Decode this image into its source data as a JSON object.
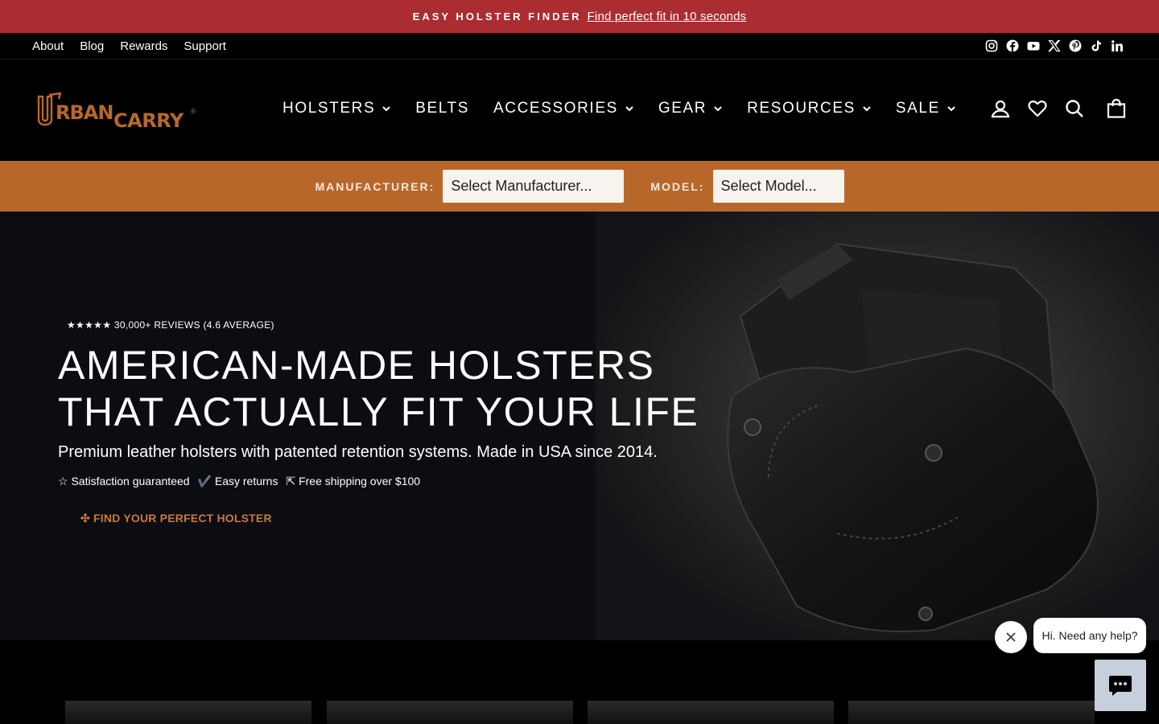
{
  "announcement": {
    "strong": "EASY HOLSTER FINDER",
    "link": "Find perfect fit in 10 seconds"
  },
  "utility": {
    "links": [
      "About",
      "Blog",
      "Rewards",
      "Support"
    ],
    "social_icons": [
      "instagram-icon",
      "facebook-icon",
      "youtube-icon",
      "x-icon",
      "pinterest-icon",
      "tiktok-icon",
      "linkedin-icon"
    ]
  },
  "header": {
    "logo_text": "URBAN CARRY",
    "nav": [
      "HOLSTERS",
      "BELTS",
      "ACCESSORIES",
      "GEAR",
      "RESOURCES",
      "SALE"
    ],
    "actions": [
      "account-icon",
      "wishlist-icon",
      "search-icon",
      "cart-icon"
    ]
  },
  "finder": {
    "manufacturer_label": "MANUFACTURER:",
    "manufacturer_value": "Select Manufacturer...",
    "model_label": "MODEL:",
    "model_value": "Select Model..."
  },
  "hero": {
    "reviews": "★★★★★ 30,000+ REVIEWS (4.6 AVERAGE)",
    "title": "AMERICAN-MADE HOLSTERS THAT ACTUALLY FIT YOUR LIFE",
    "subtitle": "Premium leather holsters with patented retention systems. Made in USA since 2014.",
    "perks": [
      "☆ Satisfaction guaranteed",
      "✔️ Easy returns",
      "⇱ Free shipping over $100"
    ],
    "cta": "✣ FIND YOUR PERFECT HOLSTER"
  },
  "chat": {
    "message": "Hi. Need any help?"
  },
  "colors": {
    "announcement": "#ab2c31",
    "finder": "#b8672b",
    "cta": "#c87841",
    "chat_button": "#c7cfdb"
  }
}
